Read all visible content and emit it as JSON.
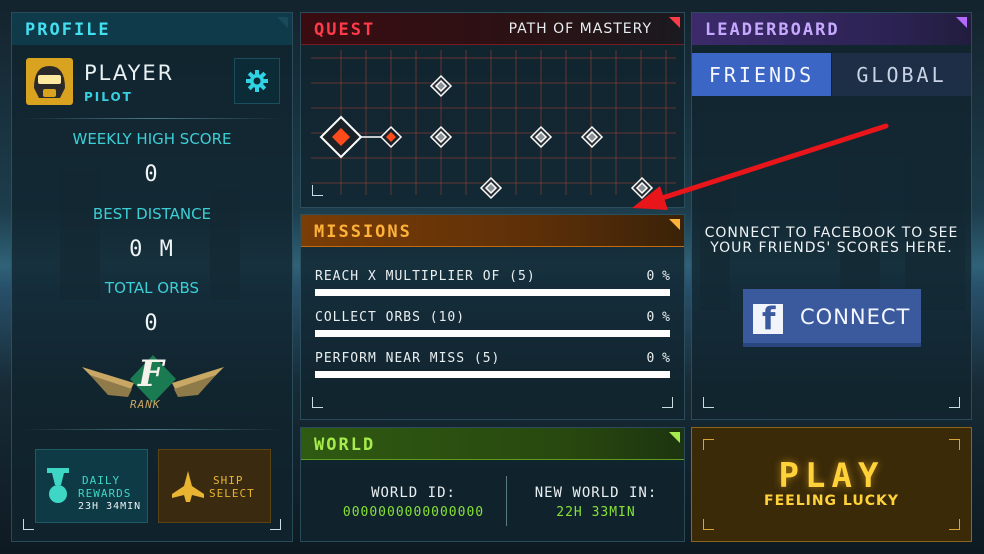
{
  "profile": {
    "title": "PROFILE",
    "player_name": "PLAYER",
    "player_rank": "PILOT",
    "settings_icon": "gear-icon",
    "stats": [
      {
        "label": "WEEKLY HIGH SCORE",
        "value": "0"
      },
      {
        "label": "BEST DISTANCE",
        "value": "0 M"
      },
      {
        "label": "TOTAL ORBS",
        "value": "0"
      }
    ],
    "rank_letter": "F",
    "rank_label": "RANK",
    "daily": {
      "line1": "DAILY",
      "line2": "REWARDS",
      "timer": "23H 34MIN"
    },
    "ship": {
      "line1": "SHIP",
      "line2": "SELECT"
    },
    "colors": {
      "accent": "#43e0f0"
    }
  },
  "quest": {
    "title": "QUEST",
    "subtitle": "PATH OF MASTERY",
    "colors": {
      "accent": "#ff3b4a",
      "active_node": "#ff4a1c"
    }
  },
  "missions": {
    "title": "MISSIONS",
    "items": [
      {
        "text": "REACH X MULTIPLIER OF (5)",
        "percent": "0 %",
        "progress": 0
      },
      {
        "text": "COLLECT ORBS (10)",
        "percent": "0 %",
        "progress": 0
      },
      {
        "text": "PERFORM NEAR MISS (5)",
        "percent": "0 %",
        "progress": 0
      }
    ],
    "colors": {
      "accent": "#ffb23a"
    }
  },
  "world": {
    "title": "WORLD",
    "id_label": "WORLD ID:",
    "id_value": "0000000000000000",
    "new_label": "NEW WORLD IN:",
    "new_value": "22H 33MIN",
    "colors": {
      "accent": "#a6ec4c"
    }
  },
  "leaderboard": {
    "title": "LEADERBOARD",
    "tabs": [
      {
        "label": "FRIENDS",
        "active": true
      },
      {
        "label": "GLOBAL",
        "active": false
      }
    ],
    "message_line1": "CONNECT TO FACEBOOK TO SEE",
    "message_line2": "YOUR FRIENDS' SCORES HERE.",
    "connect_label": "CONNECT",
    "connect_icon": "facebook-icon",
    "colors": {
      "accent": "#c7a8ff",
      "facebook": "#3b5a9e"
    }
  },
  "play": {
    "label": "PLAY",
    "sublabel": "FEELING LUCKY",
    "colors": {
      "accent": "#ffd23a"
    }
  }
}
